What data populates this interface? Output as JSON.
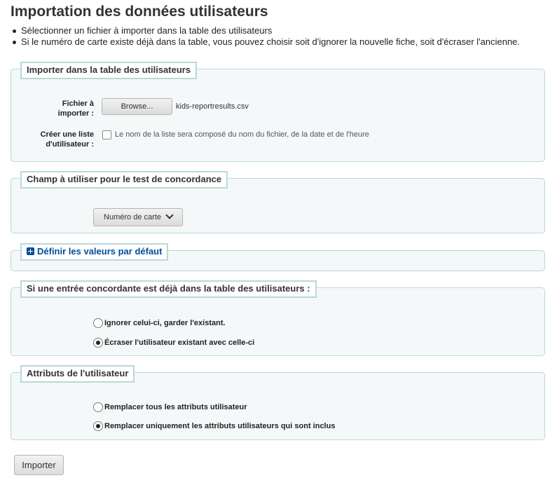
{
  "page": {
    "title": "Importation des données utilisateurs",
    "help": [
      "Sélectionner un fichier à importer dans la table des utilisateurs",
      "Si le numéro de carte existe déjà dans la table, vous pouvez choisir soit d'ignorer la nouvelle fiche, soit d'écraser l'ancienne."
    ]
  },
  "import_section": {
    "legend": "Importer dans la table des utilisateurs",
    "file_label": "Fichier à importer :",
    "browse_label": "Browse...",
    "file_name": "kids-reportresults.csv",
    "list_label": "Créer une liste d'utilisateur :",
    "list_checked": false,
    "list_hint": "Le nom de la liste sera composé du nom du fichier, de la date et de l'heure"
  },
  "match_section": {
    "legend": "Champ à utiliser pour le test de concordance",
    "selected": "Numéro de carte"
  },
  "defaults_section": {
    "legend": "Définir les valeurs par défaut",
    "icon": "plus-square-icon"
  },
  "existing_section": {
    "legend": "Si une entrée concordante est déjà dans la table des utilisateurs :",
    "options": [
      {
        "label": "Ignorer celui-ci, garder l'existant.",
        "checked": false
      },
      {
        "label": "Écraser l'utilisateur existant avec celle-ci",
        "checked": true
      }
    ]
  },
  "attributes_section": {
    "legend": "Attributs de l'utilisateur",
    "options": [
      {
        "label": "Remplacer tous les attributs utilisateur",
        "checked": false
      },
      {
        "label": "Remplacer uniquement les attributs utilisateurs qui sont inclus",
        "checked": true
      }
    ]
  },
  "submit": {
    "label": "Importer"
  },
  "colors": {
    "legend_border": "#b9d8d9",
    "fieldset_bg": "#f4f8f9",
    "link": "#004d99"
  }
}
